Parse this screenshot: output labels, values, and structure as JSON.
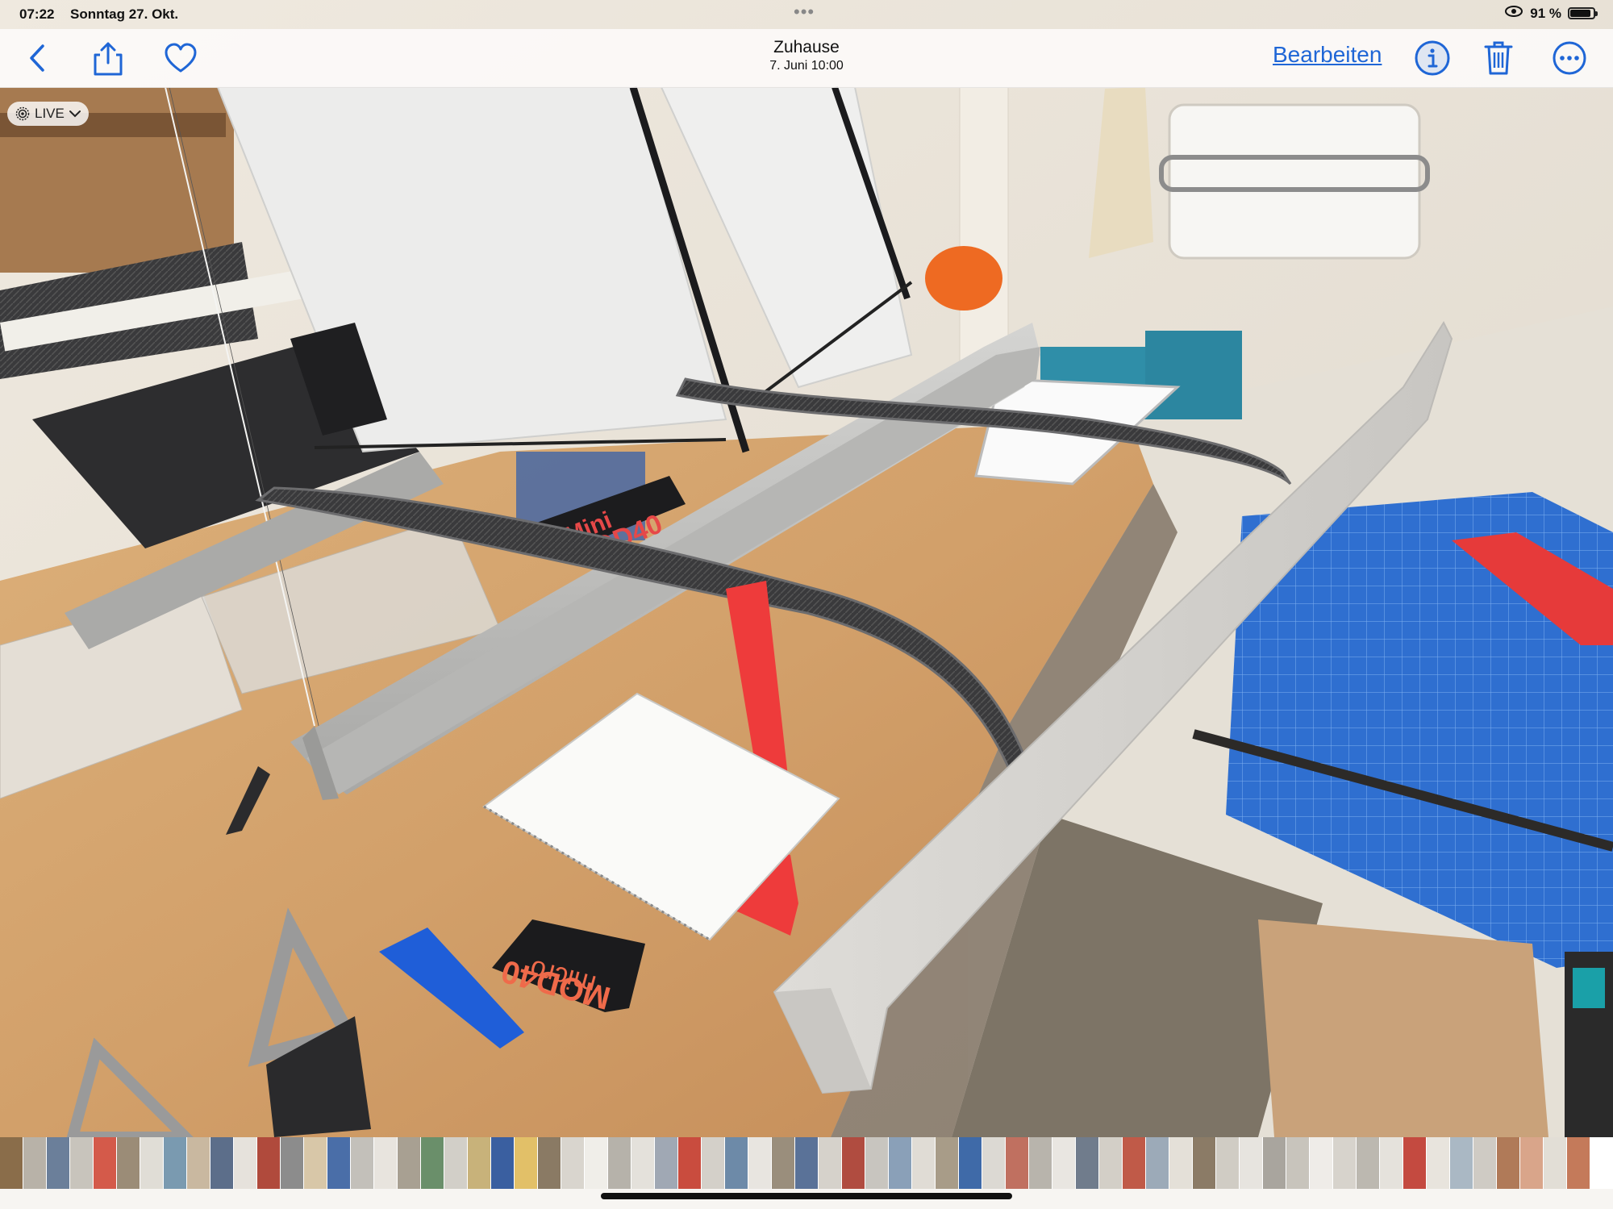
{
  "status": {
    "time": "07:22",
    "date": "Sonntag 27. Okt.",
    "battery": "91 %",
    "battery_level": 0.91
  },
  "nav": {
    "title": "Zuhause",
    "subtitle": "7. Juni  10:00",
    "edit_label": "Bearbeiten"
  },
  "photo": {
    "live_label": "LIVE",
    "label_mini": "Mini",
    "label_mod40": "MOD40",
    "label_micro": "micro",
    "label_micro_mod40": "MOD40"
  },
  "thumbnails": {
    "colors": [
      "#8a6d4a",
      "#b8b2a8",
      "#6b7f9a",
      "#c8c4bc",
      "#d45a4a",
      "#9b8c77",
      "#e0ddd6",
      "#7a9ab0",
      "#c9b8a0",
      "#5c6e8a",
      "#e6e2dc",
      "#b04a3c",
      "#8c8c8c",
      "#d8c7a8",
      "#4a6ea8",
      "#c3c0ba",
      "#e8e4de",
      "#a8a092",
      "#6a8f6a",
      "#d2cfc8",
      "#c8b27a",
      "#3a5fa0",
      "#e2c068",
      "#8a7a64",
      "#d9d5ce",
      "#f0eee9",
      "#b6b2aa",
      "#e4e1db",
      "#a0a8b4",
      "#c94c3e",
      "#d4d0c9",
      "#6d8aa8",
      "#e8e5e0",
      "#9a8e7c",
      "#5a7298",
      "#d6d2cb",
      "#b04c40",
      "#c8c5bf",
      "#8aa0b8",
      "#e0dcd5",
      "#a89c88",
      "#3f6aa8",
      "#dcd9d3",
      "#c07060",
      "#b8b4ac",
      "#e9e6e1",
      "#707c8c",
      "#d3cfc7",
      "#c05a48",
      "#9caab8",
      "#e4e0d8",
      "#8b7b66",
      "#d0ccc4",
      "#e7e4df",
      "#a9a59e",
      "#c8c4bc",
      "#efece8",
      "#d7d3cc",
      "#bcb8b0",
      "#e5e2dc",
      "#c44a40",
      "#e8e4dd",
      "#aab8c4",
      "#cfcbc4",
      "#b07a58",
      "#d9a58a",
      "#e2ded6",
      "#c47a5a"
    ]
  }
}
